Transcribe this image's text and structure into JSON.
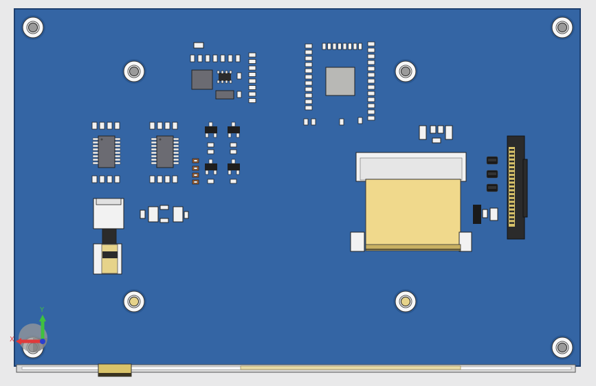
{
  "viewport": {
    "background": "#e9e9ea"
  },
  "board": {
    "color": "#3465a4",
    "edge_color": "#1e3f6e",
    "component_light": "#f2f2f2",
    "component_dark": "#2b2b2b",
    "chip_gray": "#6b6b72",
    "module_gray": "#b8b8b5",
    "flex_cable": "#f0d98c",
    "hole_white": "#f7f7f7",
    "hole_brass": "#e6d38a"
  },
  "triad": {
    "x_label": "X",
    "y_label": "Y",
    "x_color": "#e03a3a",
    "y_color": "#3fc13f",
    "z_color": "#2a3fd0"
  }
}
